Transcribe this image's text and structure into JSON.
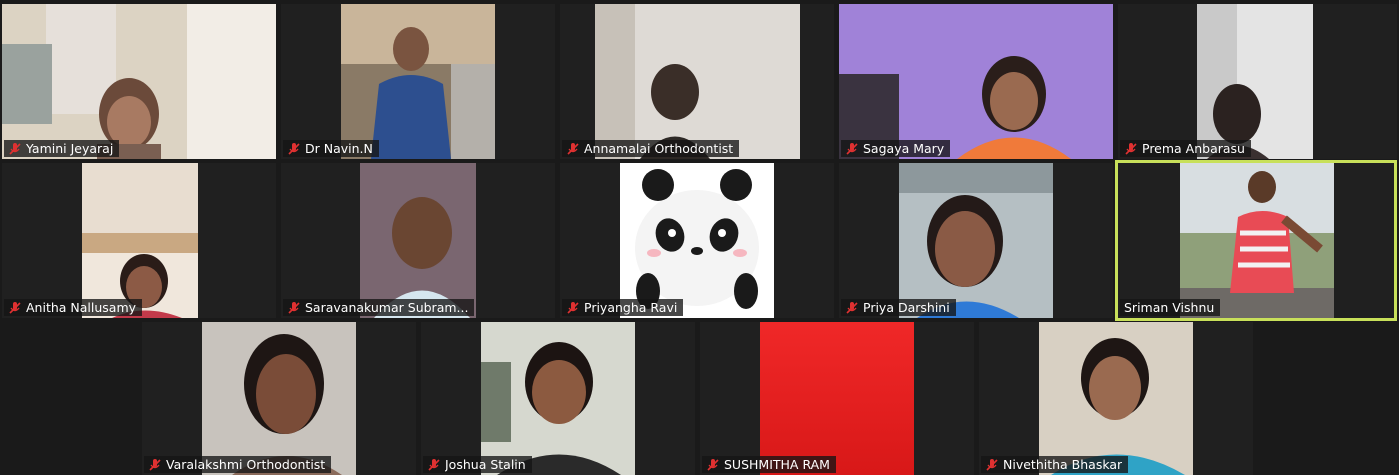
{
  "meeting": {
    "participants": [
      {
        "id": "p1",
        "name": "Yamini Jeyaraj",
        "muted": true,
        "bg": "#cfc6b4",
        "active": false
      },
      {
        "id": "p2",
        "name": "Dr Navin.N",
        "muted": true,
        "bg": "#8a7a66",
        "active": false
      },
      {
        "id": "p3",
        "name": "Annamalai Orthodontist",
        "muted": true,
        "bg": "#d9d6d2",
        "active": false
      },
      {
        "id": "p4",
        "name": "Sagaya Mary",
        "muted": true,
        "bg": "#9d7fd6",
        "active": false
      },
      {
        "id": "p5",
        "name": "Prema Anbarasu",
        "muted": true,
        "bg": "#cfcfcf",
        "active": false
      },
      {
        "id": "p6",
        "name": "Anitha Nallusamy",
        "muted": true,
        "bg": "#e3d6c4",
        "active": false
      },
      {
        "id": "p7",
        "name": "Saravanakumar Subram...",
        "muted": true,
        "bg": "#7e6a72",
        "active": false
      },
      {
        "id": "p8",
        "name": "Priyangha Ravi",
        "muted": true,
        "bg": "#ffffff",
        "active": false
      },
      {
        "id": "p9",
        "name": "Priya Darshini",
        "muted": true,
        "bg": "#b4bfc2",
        "active": false
      },
      {
        "id": "p10",
        "name": "Sriman Vishnu",
        "muted": false,
        "bg": "#d6dcdf",
        "active": true
      },
      {
        "id": "p11",
        "name": "Varalakshmi Orthodontist",
        "muted": true,
        "bg": "#c7c2bc",
        "active": false
      },
      {
        "id": "p12",
        "name": "Joshua Stalin",
        "muted": true,
        "bg": "#d4d6cd",
        "active": false
      },
      {
        "id": "p13",
        "name": "SUSHMITHA RAM",
        "muted": true,
        "bg": "#ee2020",
        "active": false
      },
      {
        "id": "p14",
        "name": "Nivethitha Bhaskar",
        "muted": true,
        "bg": "#d7d0c4",
        "active": false
      }
    ],
    "icons": {
      "muted": "muted-mic-icon"
    },
    "colors": {
      "active_border": "#c8e05a",
      "muted_icon": "#e03131"
    }
  }
}
